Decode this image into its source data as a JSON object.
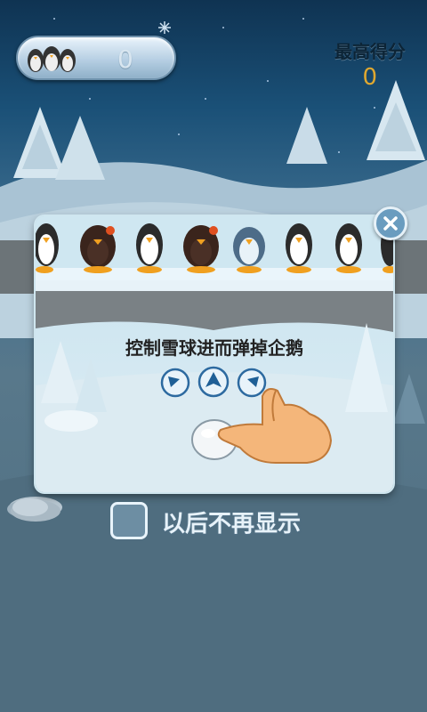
{
  "hud": {
    "score_value": "0",
    "best_label": "最高得分",
    "best_value": "0"
  },
  "tutorial": {
    "instruction": "控制雪球进而弹掉企鹅",
    "arrows": [
      "up-left-arrow",
      "up-arrow",
      "up-right-arrow"
    ]
  },
  "dont_show": {
    "label": "以后不再显示",
    "checked": false
  },
  "colors": {
    "accent_orange": "#e0a830",
    "panel_blue": "#6a9cbf"
  }
}
